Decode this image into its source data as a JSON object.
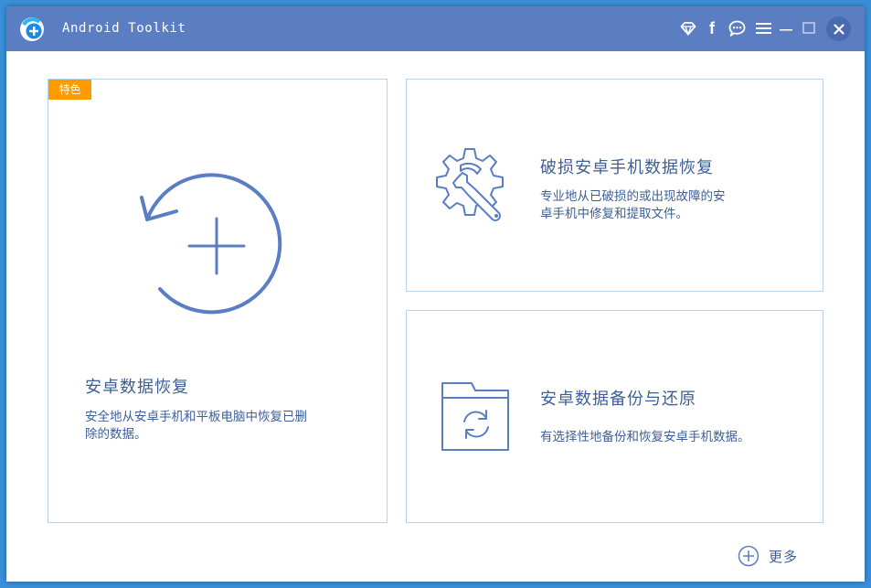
{
  "titlebar": {
    "title": "Android Toolkit",
    "icons": [
      "diamond-icon",
      "facebook-icon",
      "chat-icon",
      "menu-icon",
      "minimize-icon",
      "maximize-icon",
      "close-icon"
    ],
    "facebook_glyph": "f"
  },
  "colors": {
    "titlebar": "#5b7ec3",
    "accent": "#5b7ec3",
    "text": "#3e5f96",
    "badge": "#ff9a00",
    "border": "#b9d3e8"
  },
  "cards": {
    "main": {
      "badge": "特色",
      "title": "安卓数据恢复",
      "desc_line1": "安全地从安卓手机和平板电脑中恢复已删",
      "desc_line2": "除的数据。",
      "icon": "restore-plus-icon"
    },
    "broken": {
      "title": "破损安卓手机数据恢复",
      "desc_line1": "专业地从已破损的或出现故障的安",
      "desc_line2": "卓手机中修复和提取文件。",
      "icon": "gear-wrench-icon"
    },
    "backup": {
      "title": "安卓数据备份与还原",
      "desc": "有选择性地备份和恢复安卓手机数据。",
      "icon": "folder-sync-icon"
    }
  },
  "more": {
    "label": "更多",
    "icon": "plus-circle-icon"
  }
}
